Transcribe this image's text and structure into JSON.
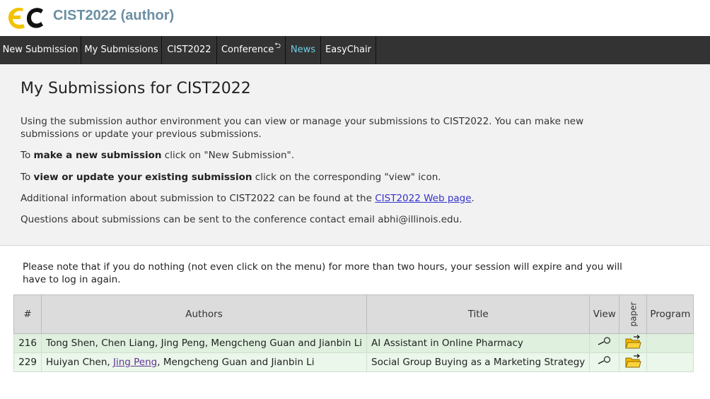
{
  "app": {
    "title": "CIST2022 (author)"
  },
  "menu": {
    "items": [
      {
        "label": "New Submission"
      },
      {
        "label": "My Submissions"
      },
      {
        "label": "CIST2022"
      },
      {
        "label": "Conference",
        "suffix_icon": "return-arrow-icon"
      },
      {
        "label": "News"
      },
      {
        "label": "EasyChair"
      }
    ]
  },
  "intro": {
    "heading": "My Submissions for CIST2022",
    "para1": "Using the submission author environment you can view or manage your submissions to CIST2022. You can make new submissions or update your previous submissions.",
    "para2_pre": "To ",
    "para2_bold": "make a new submission",
    "para2_post": " click on \"New Submission\".",
    "para3_pre": "To ",
    "para3_bold": "view or update your existing submission",
    "para3_post": " click on the corresponding \"view\" icon.",
    "para4_pre": "Additional information about submission to CIST2022 can be found at the ",
    "para4_link": "CIST2022 Web page",
    "para4_post": ".",
    "para5": "Questions about submissions can be sent to the conference contact email abhi@illinois.edu."
  },
  "note": "Please note that if you do nothing (not even click on the menu) for more than two hours, your session will expire and you will have to log in again.",
  "table": {
    "headers": {
      "num": "#",
      "authors": "Authors",
      "title": "Title",
      "view": "View",
      "paper": "paper",
      "program": "Program"
    },
    "rows": [
      {
        "num": "216",
        "authors": "Tong Shen, Chen Liang, Jing Peng, Mengcheng Guan and Jianbin Li",
        "title": "AI Assistant in Online Pharmacy"
      },
      {
        "num": "229",
        "authors_pre": "Huiyan Chen, ",
        "authors_link": "Jing Peng",
        "authors_post": ", Mengcheng Guan and Jianbin Li",
        "title": "Social Group Buying as a Marketing Strategy"
      }
    ]
  },
  "colors": {
    "menubar": "#333333",
    "news_accent": "#6ecde6",
    "title": "#6b8fa3",
    "link": "#3333cc"
  }
}
